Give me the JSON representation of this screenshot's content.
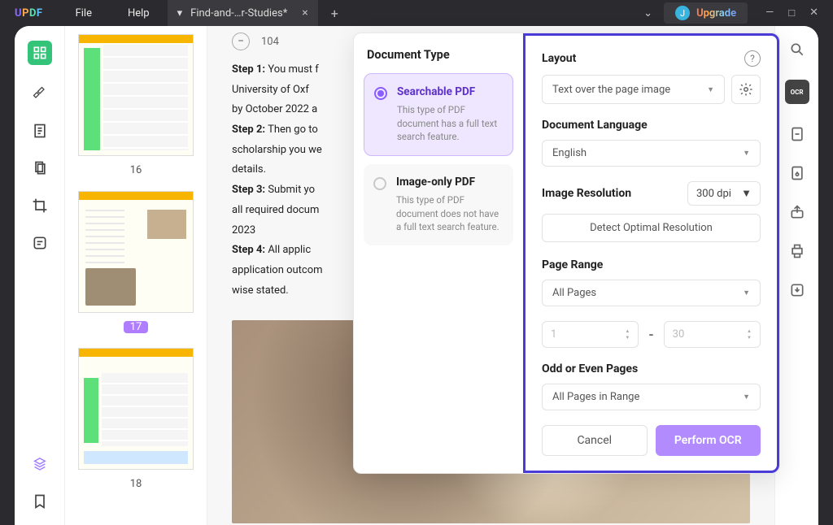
{
  "logo": {
    "u": "U",
    "p": "P",
    "d": "D",
    "f": "F"
  },
  "menu": {
    "file": "File",
    "help": "Help"
  },
  "tab": {
    "chevron": "▾",
    "title": "Find-and-…r-Studies*",
    "close": "×",
    "add": "+"
  },
  "title_right": {
    "chev": "⌄",
    "avatar_letter": "J",
    "upgrade": "Upgrade",
    "min": "—",
    "max": "□",
    "close": "✕"
  },
  "thumbs": {
    "p16": "16",
    "p17": "17",
    "p18": "18"
  },
  "doc_header": {
    "minus": "−",
    "zoom": "104"
  },
  "doc_text": {
    "s1a": "Step 1:",
    "s1b": " You must f",
    "l2": "University of Oxf",
    "l3": "by October 2022 a",
    "s2a": "Step 2:",
    "s2b": " Then go to",
    "l5": "scholarship you we",
    "l6": "details.",
    "s3a": "Step 3:",
    "s3b": " Submit yo",
    "l8": "all required docum",
    "l9": "2023",
    "s4a": "Step 4:",
    "s4b": " All applic",
    "l11": "application outcom",
    "l12": "wise stated."
  },
  "ocr": {
    "doc_type_title": "Document Type",
    "searchable_title": "Searchable PDF",
    "searchable_desc": "This type of PDF document has a full text search feature.",
    "imageonly_title": "Image-only PDF",
    "imageonly_desc": "This type of PDF document does not have a full text search feature.",
    "layout_label": "Layout",
    "help": "?",
    "layout_value": "Text over the page image",
    "lang_label": "Document Language",
    "lang_value": "English",
    "res_label": "Image Resolution",
    "res_value": "300 dpi",
    "detect": "Detect Optimal Resolution",
    "range_label": "Page Range",
    "range_value": "All Pages",
    "from": "1",
    "to": "30",
    "dash": "-",
    "odd_label": "Odd or Even Pages",
    "odd_value": "All Pages in Range",
    "cancel": "Cancel",
    "perform": "Perform OCR"
  },
  "right_tools": {
    "ocr": "OCR"
  }
}
